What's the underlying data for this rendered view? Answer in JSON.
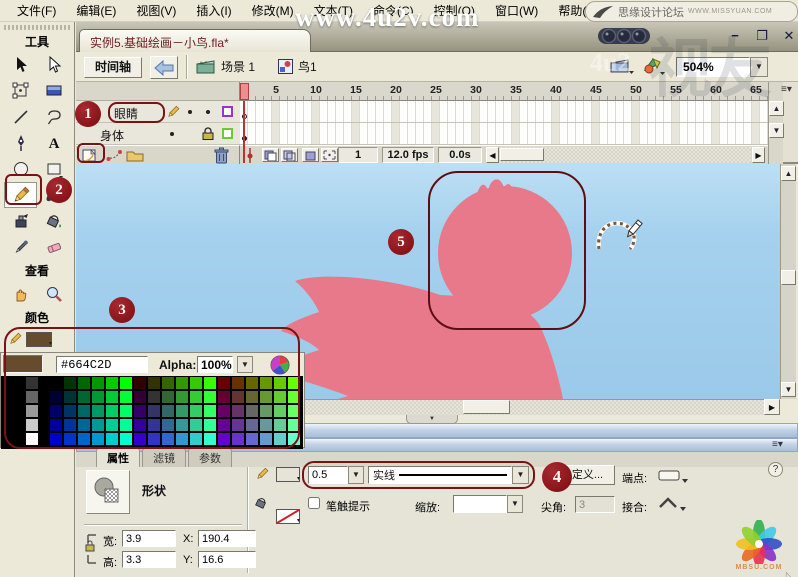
{
  "watermarks": {
    "top_center": "www.4u2v.com",
    "badge_text": "思缘设计论坛",
    "badge_domain": "WWW.MISSYUAN.COM",
    "ghost_text": "视友",
    "ghost_small": "4u2",
    "corner_logo_text": "MBSU.COM"
  },
  "menu_bar": {
    "items": [
      "文件(F)",
      "编辑(E)",
      "视图(V)",
      "插入(I)",
      "修改(M)",
      "文本(T)",
      "命令(C)",
      "控制(O)",
      "窗口(W)",
      "帮助(H)"
    ]
  },
  "document_window": {
    "tab_title": "实例5.基础绘画－小鸟.fla*",
    "minimize_glyph": "−",
    "restore_glyph": "❐",
    "close_glyph": "✕"
  },
  "edit_bar": {
    "timeline_toggle": "时间轴",
    "scene_name": "场景 1",
    "symbol_name": "鸟1",
    "zoom_value": "504%"
  },
  "tools_panel": {
    "tools_header": "工具",
    "view_header": "查看",
    "colors_header": "颜色"
  },
  "timeline": {
    "layers": [
      {
        "name": "眼睛",
        "outline_color": "#9933CC"
      },
      {
        "name": "身体",
        "outline_color": "#66CC33"
      }
    ],
    "ruler_numbers": [
      1,
      5,
      10,
      15,
      20,
      25,
      30,
      35,
      40,
      45,
      50,
      55,
      60,
      65
    ],
    "current_frame": "1",
    "frame_rate": "12.0 fps",
    "elapsed_time": "0.0s"
  },
  "color_picker": {
    "hex_value": "#664C2D",
    "alpha_label": "Alpha:",
    "alpha_value": "100%",
    "current_color": "#664C2D",
    "grayscale_column": [
      "#333333",
      "#666666",
      "#999999",
      "#CCCCCC",
      "#FFFFFF"
    ],
    "palette_rows": [
      [
        "#000000",
        "#003300",
        "#006600",
        "#009900",
        "#00CC00",
        "#00FF00",
        "#330000",
        "#333300",
        "#336600",
        "#339900",
        "#33CC00",
        "#33FF00",
        "#660000",
        "#663300",
        "#666600",
        "#669900",
        "#66CC00",
        "#66FF00"
      ],
      [
        "#000033",
        "#003333",
        "#006633",
        "#009933",
        "#00CC33",
        "#00FF33",
        "#330033",
        "#333333",
        "#336633",
        "#339933",
        "#33CC33",
        "#33FF33",
        "#660033",
        "#663333",
        "#666633",
        "#669933",
        "#66CC33",
        "#66FF33"
      ],
      [
        "#000066",
        "#003366",
        "#006666",
        "#009966",
        "#00CC66",
        "#00FF66",
        "#330066",
        "#333366",
        "#336666",
        "#339966",
        "#33CC66",
        "#33FF66",
        "#660066",
        "#663366",
        "#666666",
        "#669966",
        "#66CC66",
        "#66FF66"
      ],
      [
        "#000099",
        "#003399",
        "#006699",
        "#009999",
        "#00CC99",
        "#00FF99",
        "#330099",
        "#333399",
        "#336699",
        "#339999",
        "#33CC99",
        "#33FF99",
        "#660099",
        "#663399",
        "#666699",
        "#669999",
        "#66CC99",
        "#66FF99"
      ],
      [
        "#0000CC",
        "#0033CC",
        "#0066CC",
        "#0099CC",
        "#00CCCC",
        "#00FFCC",
        "#3300CC",
        "#3333CC",
        "#3366CC",
        "#3399CC",
        "#33CCCC",
        "#33FFCC",
        "#6600CC",
        "#6633CC",
        "#6666CC",
        "#6699CC",
        "#66CCCC",
        "#66FFCC"
      ]
    ]
  },
  "properties_panel": {
    "tabs": [
      "属性",
      "滤镜",
      "参数"
    ],
    "shape_label": "形状",
    "width_label": "宽:",
    "width_value": "3.9",
    "height_label": "高:",
    "height_value": "3.3",
    "x_label": "X:",
    "x_value": "190.4",
    "y_label": "Y:",
    "y_value": "16.6",
    "stroke_height_value": "0.5",
    "stroke_style_value": "实线",
    "custom_button": "自定义...",
    "cap_label": "端点:",
    "stroke_hint_label": "笔触提示",
    "scale_label": "缩放:",
    "miter_label": "尖角:",
    "miter_value": "3",
    "join_label": "接合:"
  },
  "callouts": {
    "c1": "1",
    "c2": "2",
    "c3": "3",
    "c4": "4",
    "c5": "5"
  },
  "stage": {
    "bird_color": "#E8798B",
    "annotation_color": "#7A1115"
  }
}
